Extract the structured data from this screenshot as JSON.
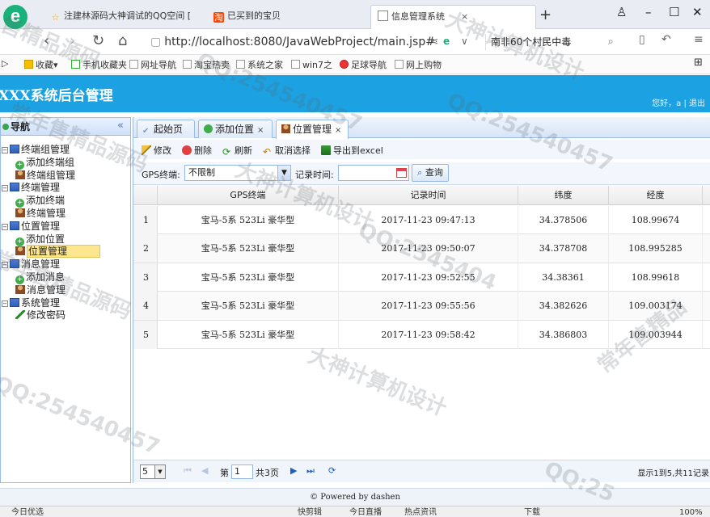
{
  "browser": {
    "tabs": [
      {
        "label": "注建林源码大神调试的QQ空间 [",
        "icon": "star-icon"
      },
      {
        "label": "已买到的宝贝",
        "icon": "taobao-icon"
      },
      {
        "label": "信息管理系统",
        "icon": "page-icon"
      }
    ],
    "address": "http://localhost:8080/JavaWebProject/main.jsp#",
    "search_text": "南非60个村民中毒",
    "bookmarks": [
      "收藏",
      "手机收藏夹",
      "网址导航",
      "淘宝热卖",
      "系统之家",
      "win7之",
      "足球导航",
      "网上购物"
    ]
  },
  "app": {
    "title": "XXX系统后台管理",
    "welcome": "您好，a | 退出"
  },
  "nav": {
    "header": "导航",
    "groups": [
      {
        "label": "终端组管理",
        "children": [
          "添加终端组",
          "终端组管理"
        ]
      },
      {
        "label": "终端管理",
        "children": [
          "添加终端",
          "终端管理"
        ]
      },
      {
        "label": "位置管理",
        "children": [
          "添加位置",
          "位置管理"
        ]
      },
      {
        "label": "消息管理",
        "children": [
          "添加消息",
          "消息管理"
        ]
      },
      {
        "label": "系统管理",
        "children": [
          "修改密码"
        ]
      }
    ],
    "selected": "位置管理"
  },
  "tabs": [
    {
      "label": "起始页"
    },
    {
      "label": "添加位置"
    },
    {
      "label": "位置管理"
    }
  ],
  "toolbar": {
    "edit": "修改",
    "delete": "删除",
    "refresh": "刷新",
    "cancel_select": "取消选择",
    "export": "导出到excel"
  },
  "filter": {
    "gps_label": "GPS终端:",
    "gps_value": "不限制",
    "time_label": "记录时间:",
    "time_value": "",
    "query": "查询"
  },
  "grid": {
    "columns": [
      "GPS终端",
      "记录时间",
      "纬度",
      "经度"
    ],
    "rows": [
      {
        "no": "1",
        "terminal": "宝马-5系 523Li 豪华型",
        "time": "2017-11-23 09:47:13",
        "lat": "34.378506",
        "lng": "108.99674"
      },
      {
        "no": "2",
        "terminal": "宝马-5系 523Li 豪华型",
        "time": "2017-11-23 09:50:07",
        "lat": "34.378708",
        "lng": "108.995285"
      },
      {
        "no": "3",
        "terminal": "宝马-5系 523Li 豪华型",
        "time": "2017-11-23 09:52:55",
        "lat": "34.38361",
        "lng": "108.99618"
      },
      {
        "no": "4",
        "terminal": "宝马-5系 523Li 豪华型",
        "time": "2017-11-23 09:55:56",
        "lat": "34.382626",
        "lng": "109.003174"
      },
      {
        "no": "5",
        "terminal": "宝马-5系 523Li 豪华型",
        "time": "2017-11-23 09:58:42",
        "lat": "34.386803",
        "lng": "109.003944"
      }
    ]
  },
  "pager": {
    "page_size": "5",
    "page_label": "第",
    "page_value": "1",
    "total_pages": "共3页",
    "info": "显示1到5,共11记录"
  },
  "footer": "© Powered by dashen",
  "statusbar": [
    "今日优选",
    "快剪辑",
    "今日直播",
    "热点资讯",
    "下载",
    "100%"
  ],
  "watermarks": [
    "售精品源码",
    "大神计算机设计",
    "QQ:254540457",
    "常年售精品源码",
    "QQ:254540457",
    "大神计算机设计",
    "常年售精品源码",
    "QQ:2545404",
    "大神计算机设计",
    "QQ:254540457",
    "常年售精品",
    "QQ:25"
  ]
}
